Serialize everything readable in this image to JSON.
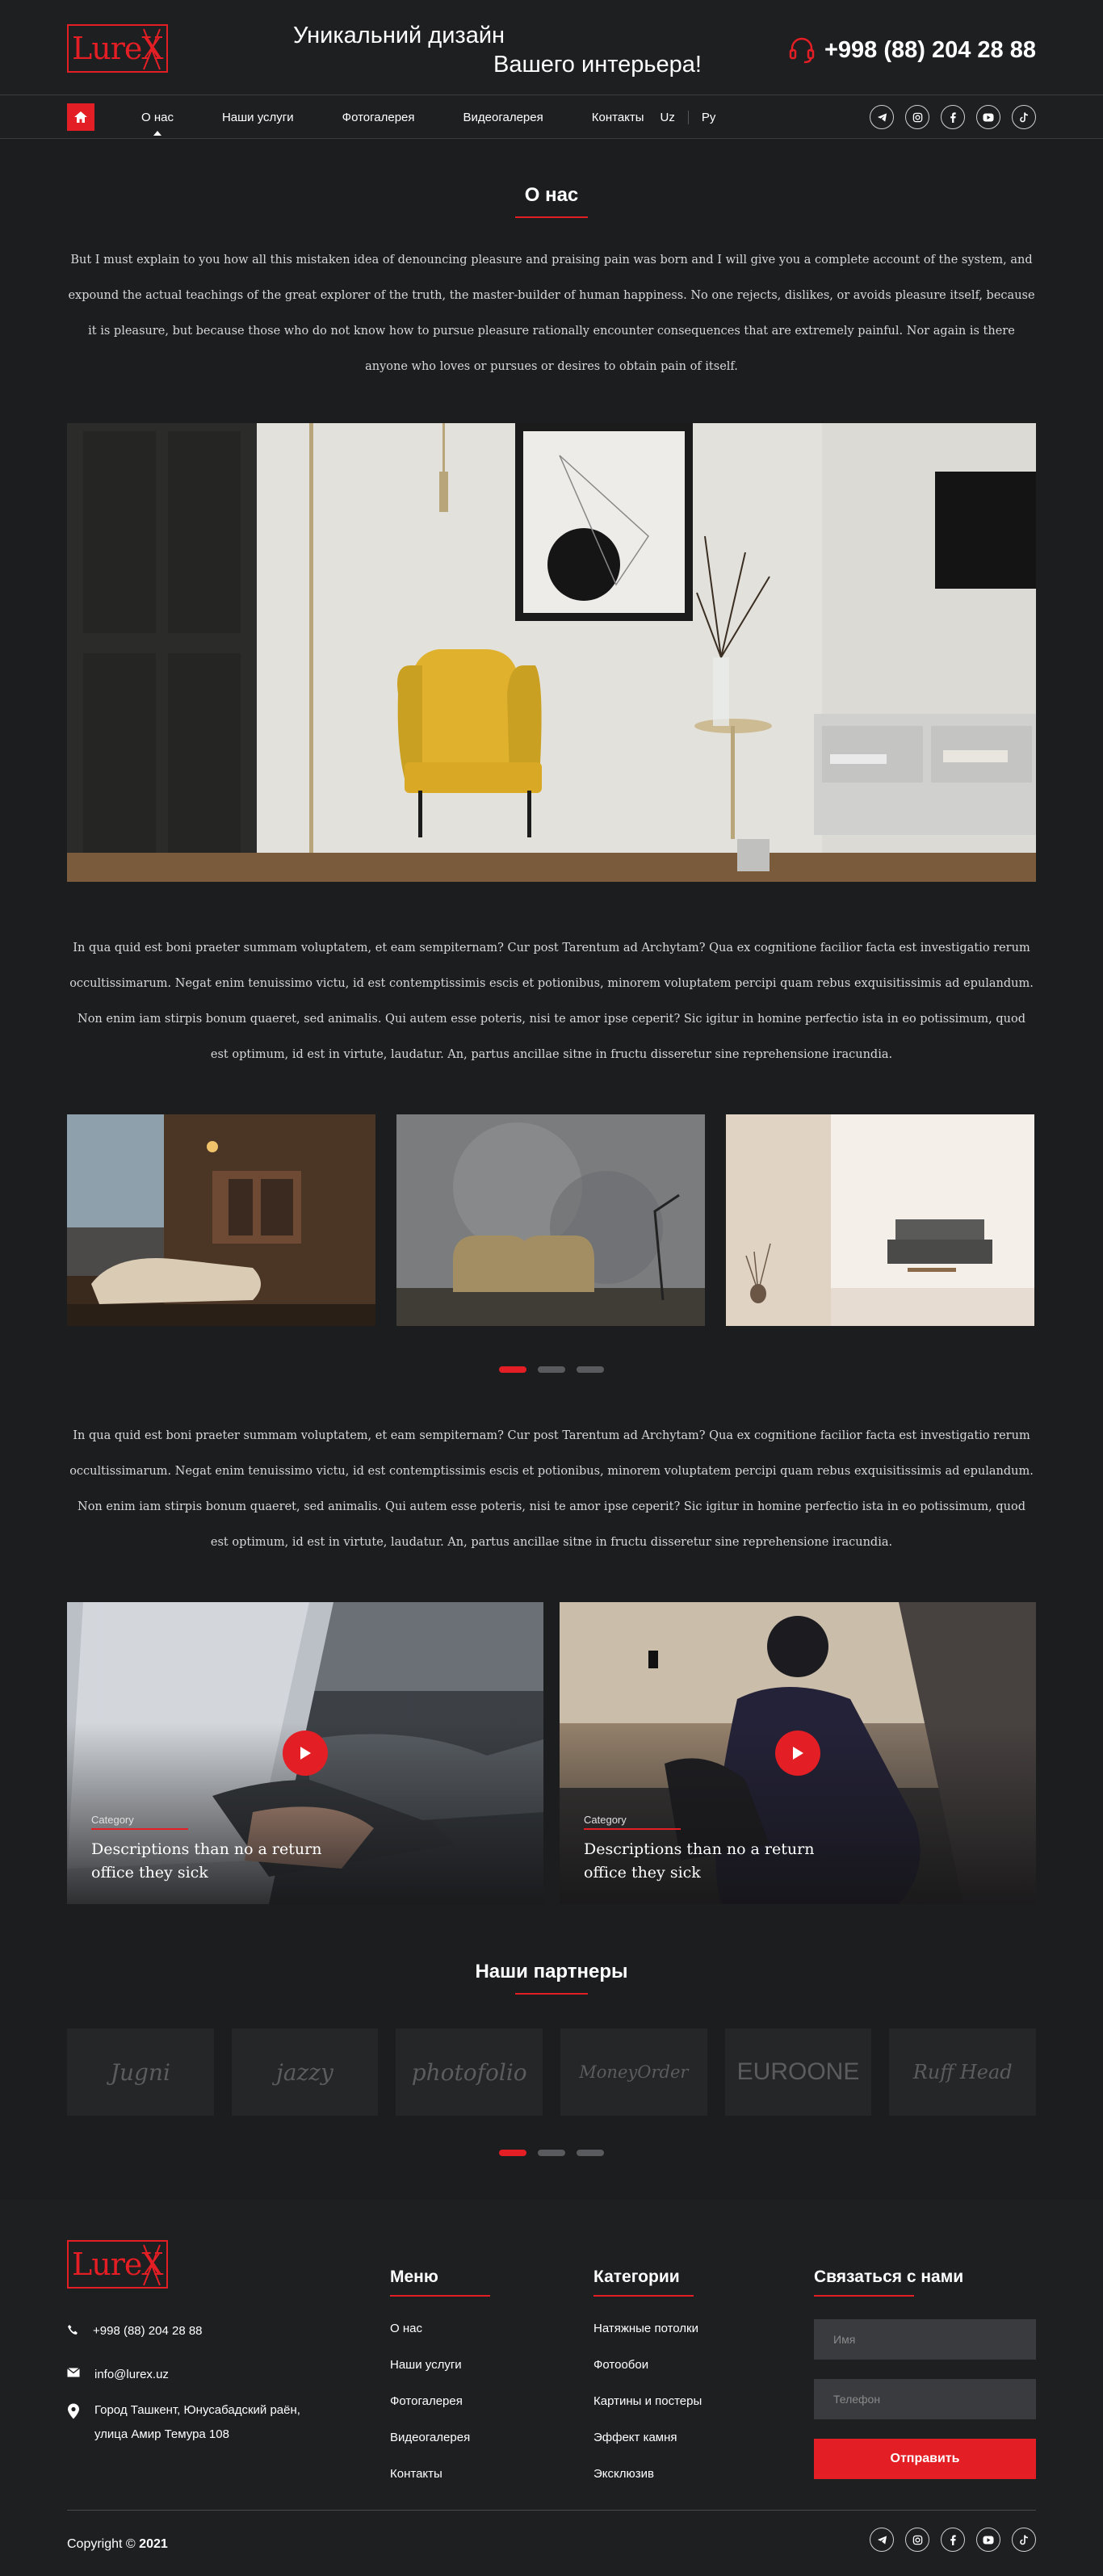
{
  "header": {
    "tagline_line1": "Уникальний дизайн",
    "tagline_line2": "Вашего интерьера!",
    "phone": "+998 (88) 204 28 88"
  },
  "nav": {
    "items": [
      {
        "label": "О нас",
        "active": true
      },
      {
        "label": "Наши услуги",
        "active": false
      },
      {
        "label": "Фотогалерея",
        "active": false
      },
      {
        "label": "Видеогалерея",
        "active": false
      },
      {
        "label": "Контакты",
        "active": false
      }
    ],
    "lang_uz": "Uz",
    "lang_ru": "Ру",
    "socials": [
      "telegram-icon",
      "instagram-icon",
      "facebook-icon",
      "youtube-icon",
      "tiktok-icon"
    ]
  },
  "about": {
    "title": "О нас",
    "intro": "But I must explain to you how all this mistaken idea of denouncing pleasure and praising pain was born and I will give you a complete account of the system, and expound the actual teachings of the great explorer of the truth, the master-builder of human happiness. No one rejects, dislikes, or avoids pleasure itself, because it is pleasure, but because those who do not know how to pursue pleasure rationally encounter consequences that are extremely painful. Nor again is there anyone who loves or pursues or desires to obtain pain of itself.",
    "para2": "In qua quid est boni praeter summam voluptatem, et eam sempiternam? Cur post Tarentum ad Archytam? Qua ex cognitione facilior facta est investigatio rerum occultissimarum. Negat enim tenuissimo victu, id est contemptissimis escis et potionibus, minorem voluptatem percipi quam rebus exquisitissimis ad epulandum. Non enim iam stirpis bonum quaeret, sed animalis. Qui autem esse poteris, nisi te amor ipse ceperit? Sic igitur in homine perfectio ista in eo potissimum, quod est optimum, id est in virtute, laudatur. An, partus ancillae sitne in fructu disseretur sine reprehensione iracundia.",
    "para3": "In qua quid est boni praeter summam voluptatem, et eam sempiternam? Cur post Tarentum ad Archytam? Qua ex cognitione facilior facta est investigatio rerum occultissimarum. Negat enim tenuissimo victu, id est contemptissimis escis et potionibus, minorem voluptatem percipi quam rebus exquisitissimis ad epulandum. Non enim iam stirpis bonum quaeret, sed animalis. Qui autem esse poteris, nisi te amor ipse ceperit? Sic igitur in homine perfectio ista in eo potissimum, quod est optimum, id est in virtute, laudatur. An, partus ancillae sitne in fructu disseretur sine reprehensione iracundia."
  },
  "videos": [
    {
      "category": "Category",
      "title": "Descriptions than no a return office they sick"
    },
    {
      "category": "Category",
      "title": "Descriptions than no a return office they sick"
    }
  ],
  "partners": {
    "title": "Наши партнеры",
    "logos": [
      "Jugni",
      "jazzy",
      "photofolio",
      "MoneyOrder",
      "EUROONE",
      "Ruff Head"
    ]
  },
  "footer": {
    "phone": "+998 (88) 204 28 88",
    "email": "info@lurex.uz",
    "address": "Город Ташкент, Юнусабадский раён, улица Амир Темура 108",
    "menu_title": "Меню",
    "menu": [
      "О нас",
      "Наши услуги",
      "Фотогалерея",
      "Видеогалерея",
      "Контакты"
    ],
    "categories_title": "Категории",
    "categories": [
      "Натяжные потолки",
      "Фотообои",
      "Картины и постеры",
      "Эффект камня",
      "Эксклюзив"
    ],
    "contact_title": "Связаться с нами",
    "name_placeholder": "Имя",
    "phone_placeholder": "Телефон",
    "submit": "Отправить",
    "copyright": "Copyright ©",
    "year": "2021"
  },
  "colors": {
    "accent": "#e31e24",
    "background": "#1c1d1f"
  }
}
